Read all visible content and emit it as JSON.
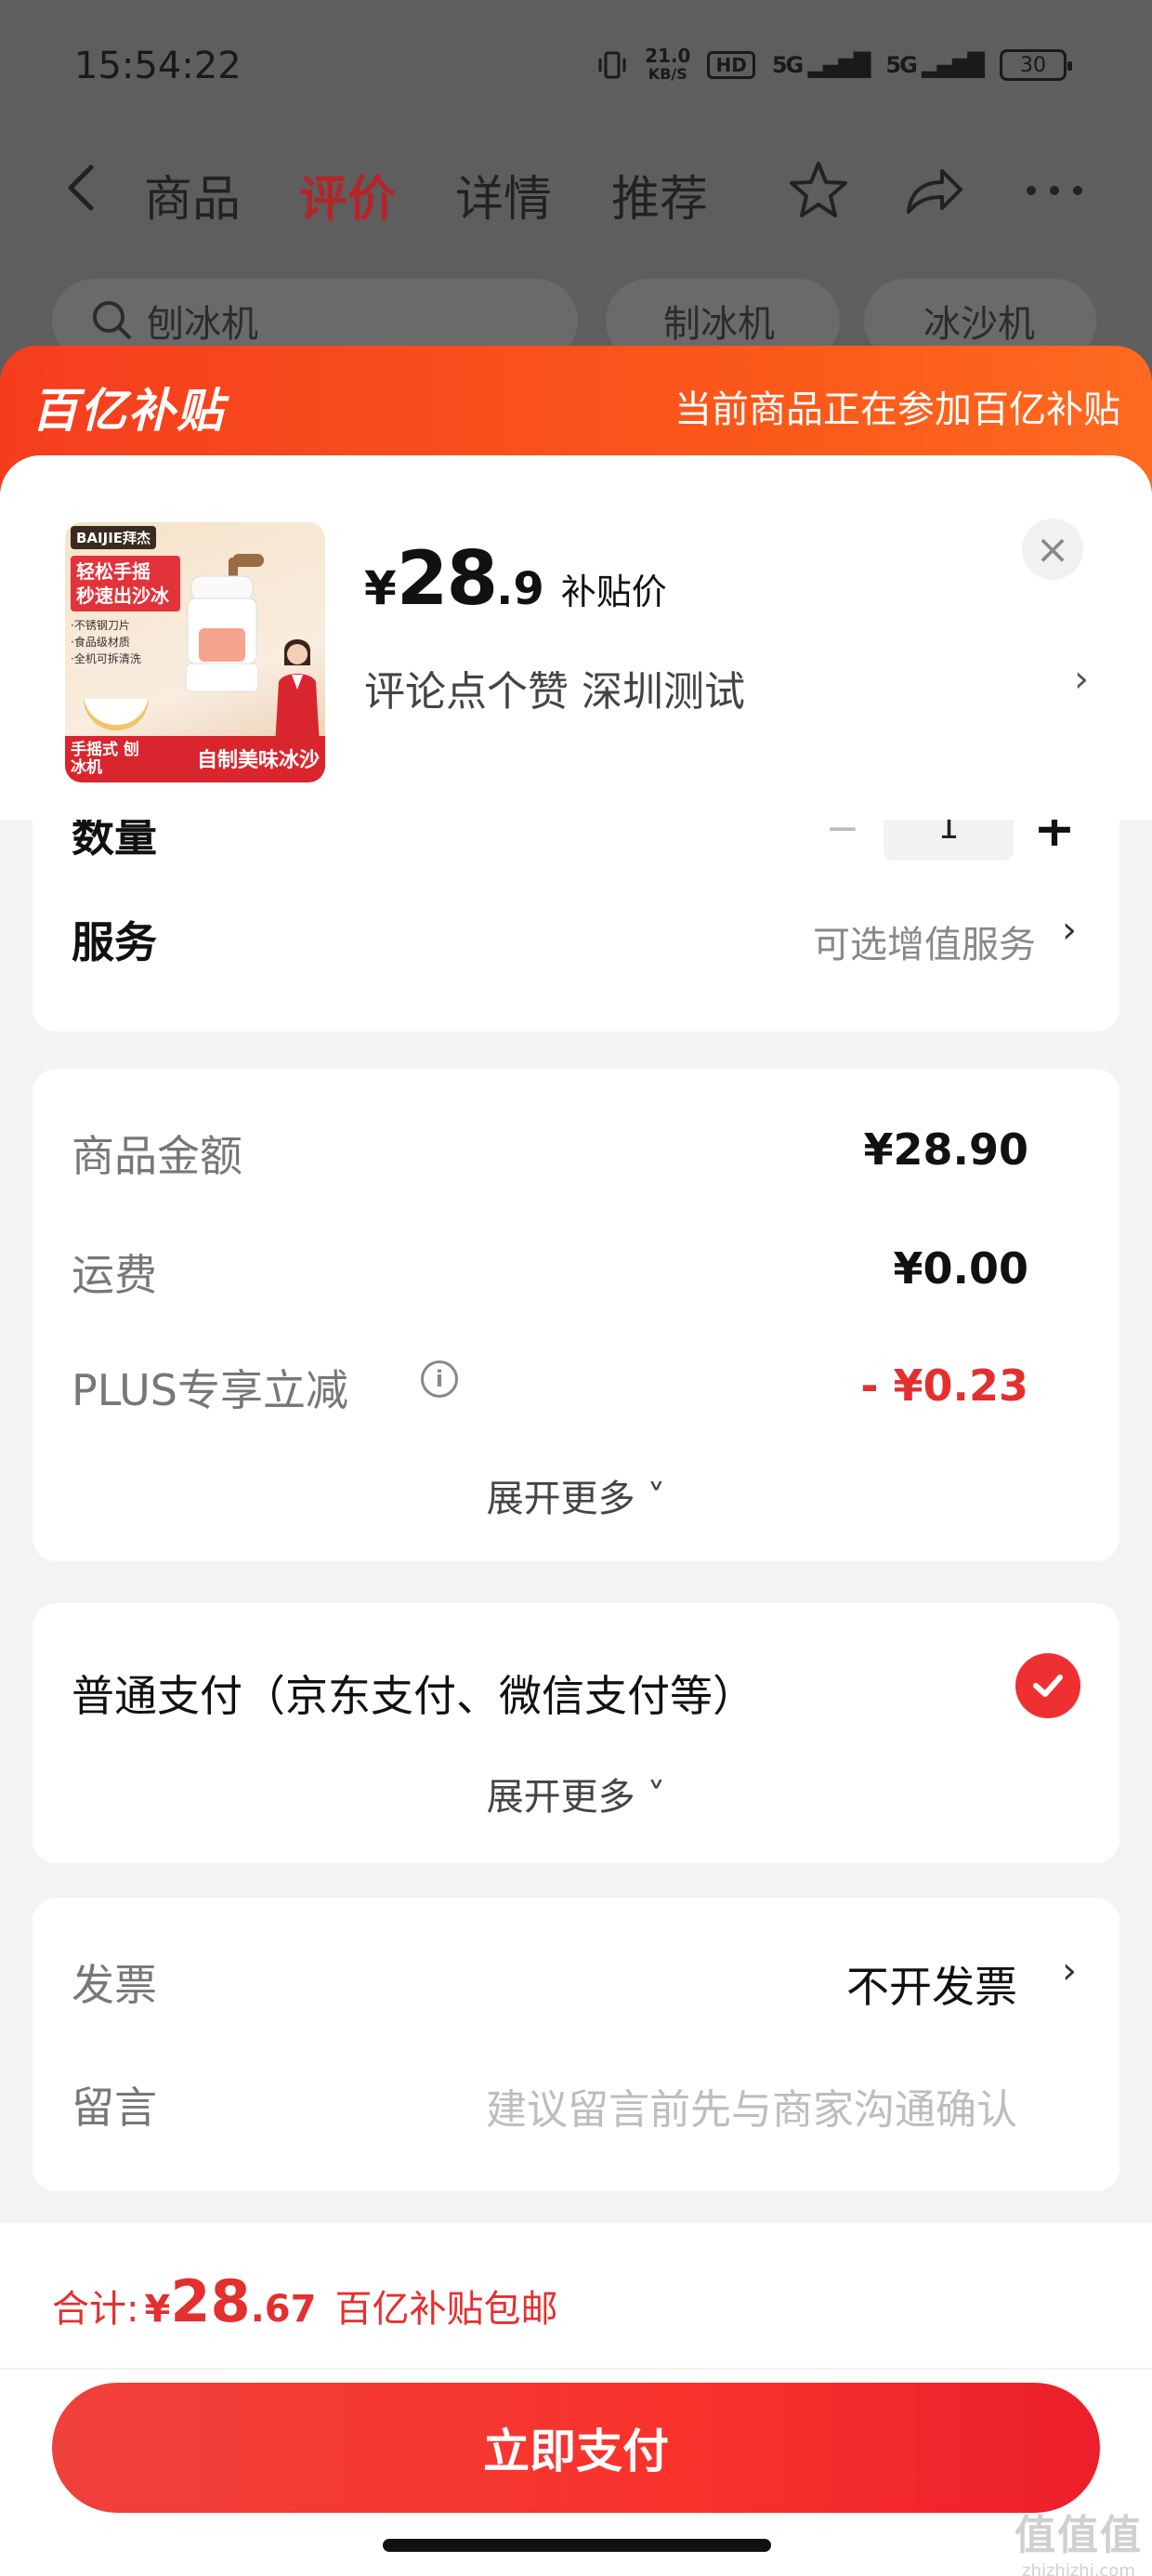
{
  "status_bar": {
    "time": "15:54:22",
    "net_speed_value": "21.0",
    "net_speed_unit": "KB/S",
    "hd_label": "HD",
    "signal_1": "5G",
    "signal_2": "5G",
    "battery": "30"
  },
  "nav": {
    "tabs": [
      {
        "label": "商品",
        "active": false
      },
      {
        "label": "评价",
        "active": true
      },
      {
        "label": "详情",
        "active": false
      },
      {
        "label": "推荐",
        "active": false
      }
    ],
    "accent_color": "#b4252a"
  },
  "search": {
    "query": "刨冰机",
    "chips": [
      "制冰机",
      "冰沙机"
    ]
  },
  "sheet_header": {
    "brand": "百亿补贴",
    "note": "当前商品正在参加百亿补贴",
    "color": "#f53d1e"
  },
  "product": {
    "thumb": {
      "brand": "BAIJIE拜杰",
      "slogan": "轻松手摇 秒速出沙冰",
      "points": [
        "·不锈钢刀片",
        "·食品级材质",
        "·全机可拆清洗"
      ],
      "bottom_left": "手摇式 刨冰机",
      "bottom_right": "自制美味冰沙"
    },
    "price_symbol": "¥",
    "price_int": "28",
    "price_dec": ".9",
    "price_tag": "补贴价",
    "spec": "评论点个赞  深圳测试",
    "close_icon": "close-icon"
  },
  "order": {
    "quantity_label": "数量",
    "quantity_value": "1",
    "minus": "−",
    "plus": "+",
    "service_label": "服务",
    "service_value": "可选增值服务"
  },
  "amounts": {
    "rows": [
      {
        "label": "商品金额",
        "value": "¥28.90"
      },
      {
        "label": "运费",
        "value": "¥0.00"
      },
      {
        "label": "PLUS专享立减",
        "value": "- ¥0.23"
      }
    ],
    "info_icon": "i",
    "expand": "展开更多 ˅",
    "discount_color": "#e3302f"
  },
  "payment": {
    "method": "普通支付（京东支付、微信支付等）",
    "selected": true,
    "expand": "展开更多 ˅"
  },
  "extras": {
    "invoice_label": "发票",
    "invoice_value": "不开发票",
    "note_label": "留言",
    "note_placeholder": "建议留言前先与商家沟通确认"
  },
  "footer": {
    "total_label": "合计:",
    "total_symbol": "¥",
    "total_int": "28",
    "total_dec": ".67",
    "total_note": "百亿补贴包邮",
    "pay_button": "立即支付",
    "button_color": "#f3332d"
  },
  "watermark": {
    "big": "值值值",
    "small": "zhizhizhi.com"
  }
}
